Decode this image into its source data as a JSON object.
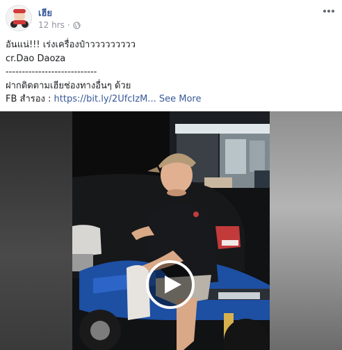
{
  "post": {
    "author": "เฮีย",
    "time": "12 hrs",
    "caption_lines": [
      "อันแน่!!! เร่งเครื่องป๋าววววววววว",
      "cr.Dao Daoza",
      "----------------------------",
      "ฝากติดตามเฮียช่องทางอื่นๆ ด้วย"
    ],
    "fb_label": "FB สำรอง : ",
    "fb_link": "https://bit.ly/2UfcIzM...",
    "see_more": "See More"
  },
  "icons": {
    "globe": "globe-icon",
    "more": "more-options-icon",
    "play": "play-icon"
  },
  "colors": {
    "link": "#385898",
    "meta": "#90949c",
    "text": "#1c1e21"
  }
}
